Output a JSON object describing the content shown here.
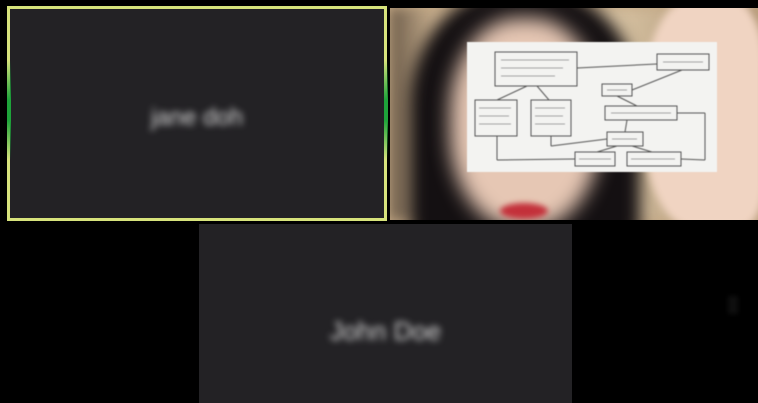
{
  "meeting": {
    "participants": [
      {
        "name": "jane doh",
        "active_speaker": true,
        "video_on": false
      },
      {
        "name": "",
        "active_speaker": false,
        "video_on": true
      },
      {
        "name": "John Doe",
        "active_speaker": false,
        "video_on": false
      }
    ]
  },
  "colors": {
    "speaker_border": "#d7e37c",
    "tile_background": "#232225",
    "page_background": "#000000",
    "speaker_edge": "#1ea43a"
  }
}
